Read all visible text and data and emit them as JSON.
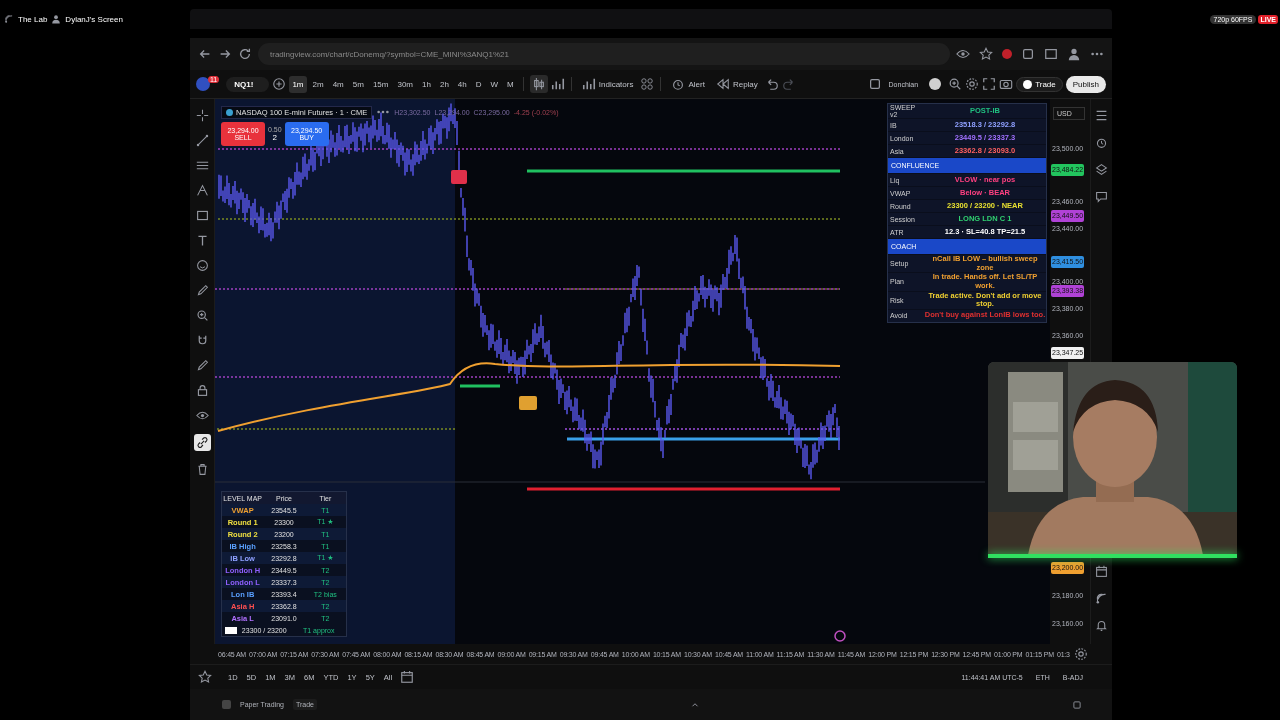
{
  "stream": {
    "title": "The Lab",
    "source": "DylanJ's Screen",
    "quality": "720p 60FPS",
    "live": "LIVE"
  },
  "browser": {
    "url": "tradingview.com/chart/cDonemq/?symbol=CME_MINI%3ANQ1%21"
  },
  "toolbar": {
    "avatar_badge": "11",
    "symbol": "NQ1!",
    "intervals": [
      {
        "label": "1m",
        "selected": true
      },
      {
        "label": "2m",
        "selected": false
      },
      {
        "label": "4m",
        "selected": false
      },
      {
        "label": "5m",
        "selected": false
      },
      {
        "label": "15m",
        "selected": false
      },
      {
        "label": "30m",
        "selected": false
      },
      {
        "label": "1h",
        "selected": false
      },
      {
        "label": "2h",
        "selected": false
      },
      {
        "label": "4h",
        "selected": false
      },
      {
        "label": "D",
        "selected": false
      },
      {
        "label": "W",
        "selected": false
      },
      {
        "label": "M",
        "selected": false
      }
    ],
    "indicators": "Indicators",
    "alert": "Alert",
    "replay": "Replay",
    "layout": "Donchian",
    "trade": "Trade",
    "publish": "Publish"
  },
  "chart": {
    "title": "NASDAQ 100 E-mini Futures · 1 · CME",
    "ohlc": [
      "H23,302.50",
      "L23,294.00",
      "C23,295.00",
      "-4.25 (-0.02%)"
    ],
    "sell": {
      "price": "23,294.00",
      "label": "SELL"
    },
    "spread": "0.50",
    "quantity": "2",
    "buy": {
      "price": "23,294.50",
      "label": "BUY"
    }
  },
  "price_axis": {
    "currency": "USD",
    "labels": [
      {
        "text": "23,500.00",
        "kind": "tick"
      },
      {
        "text": "23,484.22",
        "kind": "tag",
        "color": "#22c55e"
      },
      {
        "text": "23,460.00",
        "kind": "tick"
      },
      {
        "text": "23,449.50",
        "kind": "tag",
        "color": "#b042d6"
      },
      {
        "text": "23,440.00",
        "kind": "tick"
      },
      {
        "text": "23,415.50",
        "kind": "tag",
        "color": "#2f8fe0"
      },
      {
        "text": "23,400.00",
        "kind": "tick"
      },
      {
        "text": "23,393.38",
        "kind": "tag",
        "color": "#b042d6"
      },
      {
        "text": "23,380.00",
        "kind": "tick"
      },
      {
        "text": "23,360.00",
        "kind": "tick"
      },
      {
        "text": "23,347.25",
        "kind": "tag",
        "color": "#f2f2f2"
      },
      {
        "text": "23,200.00",
        "kind": "tag",
        "color": "#f0a030"
      },
      {
        "text": "23,180.00",
        "kind": "tick"
      },
      {
        "text": "23,160.00",
        "kind": "tick"
      }
    ]
  },
  "sweep_panel": {
    "title": "SWEEP v2",
    "status": "POST-IB",
    "rows": [
      {
        "label": "IB",
        "value": "23518.3 / 23292.8",
        "kind": "row",
        "color": "#8fa0ff"
      },
      {
        "label": "London",
        "value": "23449.5 / 23337.3",
        "kind": "row",
        "color": "#a070ff"
      },
      {
        "label": "Asia",
        "value": "23362.8 / 23093.0",
        "kind": "row",
        "color": "#ff6060"
      },
      {
        "label": "CONFLUENCE",
        "kind": "section"
      },
      {
        "label": "Liq",
        "value": "VLOW · near pos",
        "kind": "row",
        "color": "#ff4080"
      },
      {
        "label": "VWAP",
        "value": "Below · BEAR",
        "kind": "row",
        "color": "#ff4080"
      },
      {
        "label": "Round",
        "value": "23300 / 23200 · NEAR",
        "kind": "row",
        "color": "#e8e030"
      },
      {
        "label": "Session",
        "value": "LONG LDN C 1",
        "kind": "row",
        "color": "#30d070"
      },
      {
        "label": "ATR",
        "value": "12.3 · SL=40.8 TP=21.5",
        "kind": "row",
        "color": "#ffffff"
      },
      {
        "label": "COACH",
        "kind": "section"
      },
      {
        "label": "Setup",
        "value": "nCall IB LOW – bullish sweep zone",
        "kind": "row",
        "color": "#f0a030"
      },
      {
        "label": "Plan",
        "value": "In trade. Hands off. Let SL/TP work.",
        "kind": "row",
        "color": "#f0a030"
      },
      {
        "label": "Risk",
        "value": "Trade active. Don't add or move stop.",
        "kind": "row",
        "color": "#f0d030"
      },
      {
        "label": "Avoid",
        "value": "Don't buy against LonIB lows too.",
        "kind": "row",
        "color": "#e03030"
      }
    ]
  },
  "level_map": {
    "columns": [
      "LEVEL MAP",
      "Price",
      "Tier"
    ],
    "rows": [
      {
        "name": "VWAP",
        "price": "23545.5",
        "tier": "T1",
        "color": "#f0a030"
      },
      {
        "name": "Round 1",
        "price": "23300",
        "tier": "T1 ★",
        "color": "#f0e040"
      },
      {
        "name": "Round 2",
        "price": "23200",
        "tier": "T1",
        "color": "#f0e040"
      },
      {
        "name": "IB High",
        "price": "23258.3",
        "tier": "T1",
        "color": "#5aa0ff"
      },
      {
        "name": "IB Low",
        "price": "23292.8",
        "tier": "T1 ★",
        "color": "#8fa0ff"
      },
      {
        "name": "London H",
        "price": "23449.5",
        "tier": "T2",
        "color": "#9060ff"
      },
      {
        "name": "London L",
        "price": "23337.3",
        "tier": "T2",
        "color": "#9060ff"
      },
      {
        "name": "Lon IB",
        "price": "23393.4",
        "tier": "T2 bias",
        "color": "#5aa0ff"
      },
      {
        "name": "Asia H",
        "price": "23362.8",
        "tier": "T2",
        "color": "#ff5050"
      },
      {
        "name": "Asia L",
        "price": "23091.0",
        "tier": "T2",
        "color": "#b070ff"
      }
    ],
    "footer": {
      "price": "23300 / 23200",
      "tier": "T1 approx"
    }
  },
  "time_axis": {
    "labels": [
      "06:45 AM",
      "07:00 AM",
      "07:15 AM",
      "07:30 AM",
      "07:45 AM",
      "08:00 AM",
      "08:15 AM",
      "08:30 AM",
      "08:45 AM",
      "09:00 AM",
      "09:15 AM",
      "09:30 AM",
      "09:45 AM",
      "10:00 AM",
      "10:15 AM",
      "10:30 AM",
      "10:45 AM",
      "11:00 AM",
      "11:15 AM",
      "11:30 AM",
      "11:45 AM",
      "12:00 PM",
      "12:15 PM",
      "12:30 PM",
      "12:45 PM",
      "01:00 PM",
      "01:15 PM",
      "01:3"
    ]
  },
  "ranges": [
    "1D",
    "5D",
    "1M",
    "3M",
    "6M",
    "YTD",
    "1Y",
    "5Y",
    "All"
  ],
  "status": {
    "clock": "11:44:41 AM UTC-5",
    "session": "ETH",
    "adjust": "B-ADJ"
  },
  "bottom_bar": {
    "tabs": [
      "Paper Trading",
      "Trade"
    ]
  },
  "webcam": {
    "kind": "picture"
  }
}
